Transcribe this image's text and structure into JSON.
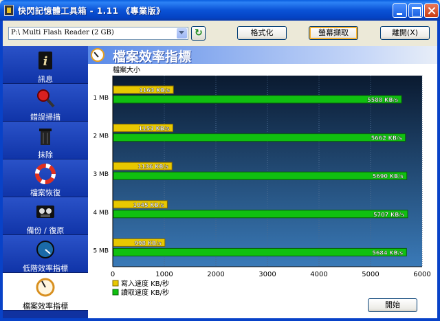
{
  "window": {
    "title": "快閃記憶體工具箱 - 1.11 《專業版》"
  },
  "toolbar": {
    "drive": "P:\\ Multi   Flash Reader (2 GB)",
    "format_label": "格式化",
    "capture_label": "螢幕擷取",
    "exit_label": "離開(X)"
  },
  "sidebar": {
    "items": [
      {
        "label": "訊息",
        "icon": "info-icon"
      },
      {
        "label": "錯誤掃描",
        "icon": "magnifier-icon"
      },
      {
        "label": "抹除",
        "icon": "trash-icon"
      },
      {
        "label": "檔案恢復",
        "icon": "lifebuoy-icon"
      },
      {
        "label": "備份 / 復原",
        "icon": "tape-icon"
      },
      {
        "label": "低階效率指標",
        "icon": "gauge-icon"
      },
      {
        "label": "檔案效率指標",
        "icon": "gauge-icon"
      }
    ],
    "active_index": 6
  },
  "content": {
    "title": "檔案效率指標",
    "start_label": "開始"
  },
  "chart_data": {
    "type": "bar",
    "orientation": "horizontal",
    "title": "",
    "ylabel": "檔案大小",
    "xlim": [
      0,
      6000
    ],
    "x_ticks": [
      "0",
      "1000",
      "2000",
      "3000",
      "4000",
      "5000",
      "6000"
    ],
    "categories": [
      "1 MB",
      "2 MB",
      "3 MB",
      "4 MB",
      "5 MB"
    ],
    "series": [
      {
        "name": "寫入速度 KB/秒",
        "color": "#e8c800",
        "values": [
          1163,
          1153,
          1136,
          1045,
          998
        ],
        "labels": [
          "1163 KB/s",
          "1153 KB/s",
          "1136 KB/s",
          "1045 KB/s",
          "998 KB/s"
        ]
      },
      {
        "name": "讀取速度 KB/秒",
        "color": "#10c010",
        "values": [
          5588,
          5662,
          5690,
          5707,
          5684
        ],
        "labels": [
          "5588 KB/s",
          "5662 KB/s",
          "5690 KB/s",
          "5707 KB/s",
          "5684 KB/s"
        ]
      }
    ],
    "grid": true,
    "legend_position": "bottom-left"
  }
}
